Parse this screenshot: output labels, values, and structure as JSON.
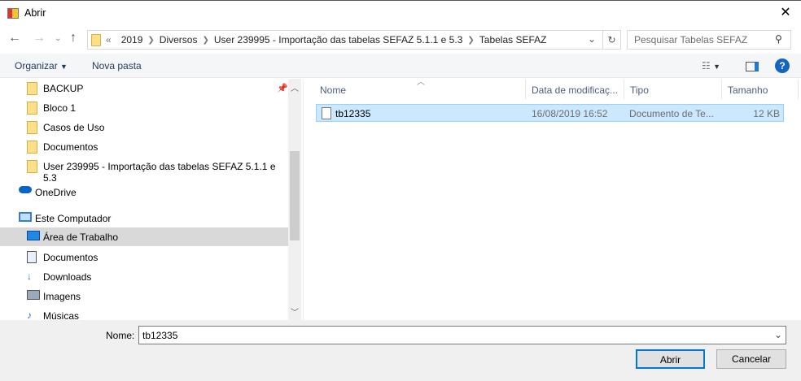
{
  "window": {
    "title": "Abrir",
    "close": "✕"
  },
  "address": {
    "overflow": "«",
    "crumbs": [
      "2019",
      "Diversos",
      "User 239995 - Importação das tabelas SEFAZ 5.1.1 e 5.3",
      "Tabelas SEFAZ"
    ]
  },
  "search": {
    "placeholder": "Pesquisar Tabelas SEFAZ"
  },
  "toolbar": {
    "organize": "Organizar",
    "new_folder": "Nova pasta"
  },
  "nav": {
    "items": [
      {
        "label": "BACKUP",
        "icon": "folder-icon"
      },
      {
        "label": "Bloco 1",
        "icon": "folder-icon"
      },
      {
        "label": "Casos de Uso",
        "icon": "folder-icon"
      },
      {
        "label": "Documentos",
        "icon": "folder-icon"
      },
      {
        "label": "User 239995 - Importação das tabelas SEFAZ 5.1.1 e 5.3",
        "icon": "folder-icon"
      },
      {
        "label": "OneDrive",
        "icon": "cloud-icon"
      },
      {
        "label": "Este Computador",
        "icon": "computer-icon"
      },
      {
        "label": "Área de Trabalho",
        "icon": "desktop-icon"
      },
      {
        "label": "Documentos",
        "icon": "document-icon"
      },
      {
        "label": "Downloads",
        "icon": "download-icon"
      },
      {
        "label": "Imagens",
        "icon": "image-icon"
      },
      {
        "label": "Músicas",
        "icon": "music-icon"
      }
    ]
  },
  "columns": {
    "name": "Nome",
    "date": "Data de modificaç...",
    "type": "Tipo",
    "size": "Tamanho"
  },
  "files": [
    {
      "name": "tb12335",
      "date": "16/08/2019 16:52",
      "type": "Documento de Te...",
      "size": "12 KB"
    }
  ],
  "footer": {
    "name_label": "Nome:",
    "name_value": "tb12335",
    "open": "Abrir",
    "cancel": "Cancelar"
  }
}
